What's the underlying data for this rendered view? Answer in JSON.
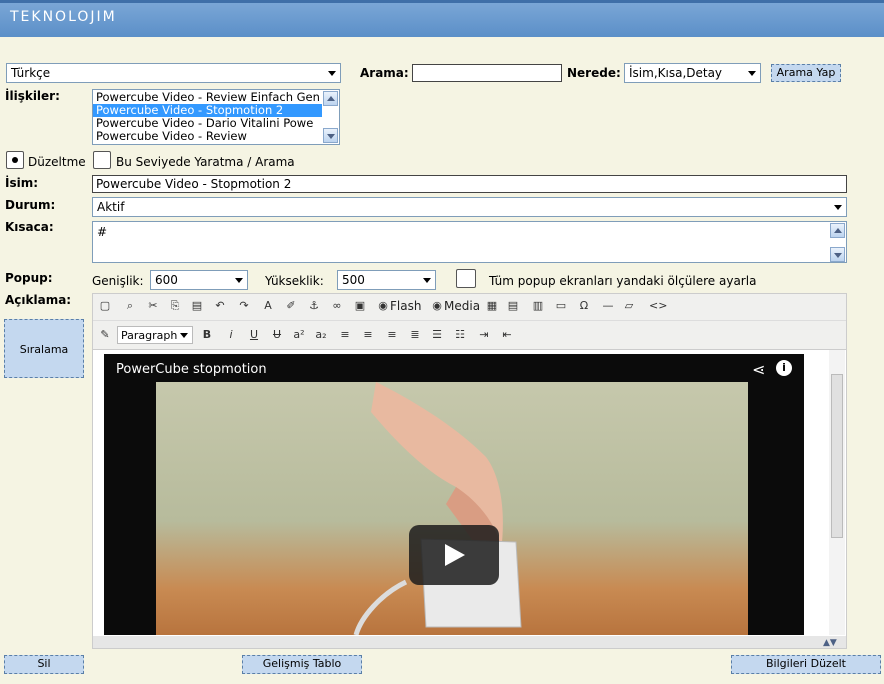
{
  "app": {
    "brand": "TEKNOLOJIM"
  },
  "language": {
    "selected": "Türkçe"
  },
  "search": {
    "label": "Arama:",
    "value": "",
    "where_label": "Nerede:",
    "where_selected": "İsim,Kısa,Detay",
    "button": "Arama Yap"
  },
  "relations": {
    "label": "İlişkiler:",
    "items": [
      {
        "text": "Powercube Video - Review Einfach Gen",
        "selected": false
      },
      {
        "text": "Powercube Video - Stopmotion 2",
        "selected": true
      },
      {
        "text": "Powercube Video - Dario Vitalini Powe",
        "selected": false
      },
      {
        "text": "Powercube Video - Review",
        "selected": false
      }
    ]
  },
  "mode": {
    "edit_label": "Düzeltme",
    "create_label": "Bu Seviyede Yaratma / Arama",
    "edit_selected": true
  },
  "name": {
    "label": "İsim:",
    "value": "Powercube Video - Stopmotion 2"
  },
  "status": {
    "label": "Durum:",
    "selected": "Aktif"
  },
  "short": {
    "label": "Kısaca:",
    "value": "#"
  },
  "popup": {
    "label": "Popup:",
    "width_label": "Genişlik:",
    "width_value": "600",
    "height_label": "Yükseklik:",
    "height_value": "500",
    "all_label": "Tüm popup ekranları yandaki ölçülere ayarla"
  },
  "description": {
    "label": "Açıklama:"
  },
  "sort_button": "Sıralama",
  "editor": {
    "toolbar1": [
      "new-document",
      "find",
      "cut",
      "copy",
      "paste",
      "undo",
      "redo",
      "text-color",
      "highlight",
      "anchor",
      "link",
      "image"
    ],
    "flash_label": "Flash",
    "media_label": "Media",
    "toolbar1_tail": [
      "table",
      "edit-table",
      "grid",
      "hr-layer",
      "omega",
      "horizontal-rule",
      "eraser",
      "code"
    ],
    "format_selected": "Paragraph",
    "toolbar2": [
      "bold",
      "italic",
      "underline",
      "strikethrough",
      "superscript",
      "subscript",
      "align-left",
      "align-center",
      "align-right",
      "justify",
      "ordered-list",
      "unordered-list",
      "indent",
      "outdent"
    ],
    "bold_glyph": "B",
    "italic_glyph": "i",
    "underline_glyph": "U",
    "strike_glyph": "U",
    "sup_glyph": "a²",
    "sub_glyph": "a₂"
  },
  "video": {
    "title": "PowerCube stopmotion"
  },
  "bottom": {
    "delete": "Sil",
    "advanced_table": "Gelişmiş Tablo",
    "save": "Bilgileri Düzelt"
  }
}
